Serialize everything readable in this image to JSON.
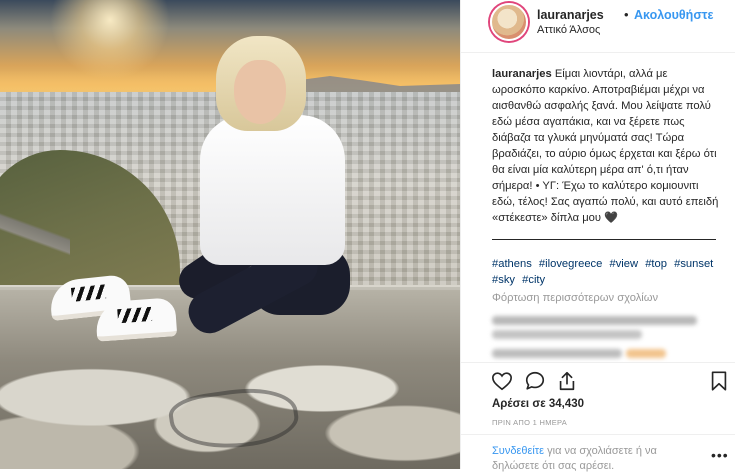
{
  "header": {
    "username": "lauranarjes",
    "separator": "•",
    "follow_label": "Ακολουθήστε",
    "location": "Αττικό Άλσος"
  },
  "caption": {
    "username": "lauranarjes",
    "text": "Είμαι λιοντάρι, αλλά με ωροσκόπο καρκίνο. Αποτραβιέμαι μέχρι να αισθανθώ ασφαλής ξανά. Μου λείψατε πολύ εδώ μέσα αγαπάκια, και να ξέρετε πως διάβαζα τα γλυκά μηνύματά σας! Τώρα βραδιάζει, το αύριο όμως έρχεται και ξέρω ότι θα είναι μία καλύτερη μέρα απ' ό,τι ήταν σήμερα! • ΥΓ: Έχω το καλύτερο κομιουνιτι εδώ, τέλος! Σας αγαπώ πολύ, και αυτό επειδή «στέκεστε» δίπλα μου 🖤"
  },
  "hashtags": [
    "#athens",
    "#ilovegreece",
    "#view",
    "#top",
    "#sunset",
    "#sky",
    "#city"
  ],
  "comments": {
    "load_more_label": "Φόρτωση περισσότερων σχολίων"
  },
  "actions": {
    "like_icon": "heart-icon",
    "comment_icon": "comment-icon",
    "share_icon": "share-icon",
    "save_icon": "bookmark-icon"
  },
  "stats": {
    "likes_text": "Αρέσει σε 34,430",
    "time_ago": "ΠΡΙΝ ΑΠΟ 1 ΗΜΕΡΑ"
  },
  "comment_box": {
    "login_link": "Συνδεθείτε",
    "login_rest": " για να σχολιάσετε ή να δηλώσετε ότι σας αρέσει.",
    "more_label": "•••"
  },
  "colors": {
    "link_blue": "#3897f0",
    "hashtag_blue": "#003569",
    "muted_gray": "#999999",
    "text": "#262626"
  }
}
